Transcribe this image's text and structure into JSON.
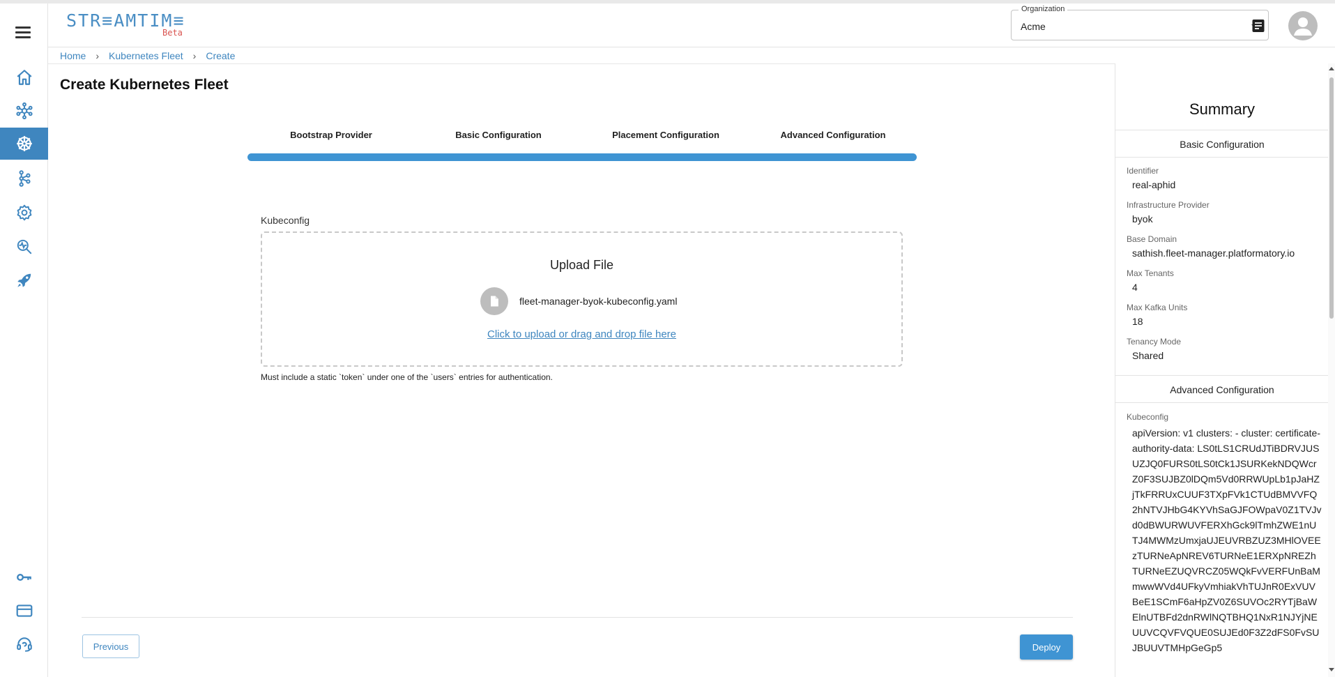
{
  "header": {
    "logo": "STR≡AMTIM≡",
    "logo_badge": "Beta",
    "organization_label": "Organization",
    "organization_value": "Acme"
  },
  "sidebar": {
    "items": [
      {
        "icon": "home-icon"
      },
      {
        "icon": "cluster-network-icon"
      },
      {
        "icon": "kubernetes-wheel-icon",
        "active": true
      },
      {
        "icon": "hub-nodes-icon"
      },
      {
        "icon": "settings-gear-icon"
      },
      {
        "icon": "monitoring-search-icon"
      },
      {
        "icon": "rocket-icon"
      },
      {
        "icon": "key-icon"
      },
      {
        "icon": "credit-card-icon"
      },
      {
        "icon": "support-headset-icon"
      }
    ],
    "accent_color": "#3f86bf"
  },
  "breadcrumb": [
    "Home",
    "Kubernetes Fleet",
    "Create"
  ],
  "page_title": "Create Kubernetes Fleet",
  "stepper": {
    "steps": [
      "Bootstrap Provider",
      "Basic Configuration",
      "Placement Configuration",
      "Advanced Configuration"
    ],
    "progress": 1.0
  },
  "upload": {
    "field_label": "Kubeconfig",
    "title": "Upload File",
    "file_name": "fleet-manager-byok-kubeconfig.yaml",
    "link_text": "Click to upload or drag and drop file here",
    "helper_text": "Must include a static `token` under one of the `users` entries for authentication."
  },
  "actions": {
    "previous_label": "Previous",
    "deploy_label": "Deploy"
  },
  "summary": {
    "title": "Summary",
    "basic_heading": "Basic Configuration",
    "fields": [
      {
        "label": "Identifier",
        "value": "real-aphid"
      },
      {
        "label": "Infrastructure Provider",
        "value": "byok"
      },
      {
        "label": "Base Domain",
        "value": "sathish.fleet-manager.platformatory.io"
      },
      {
        "label": "Max Tenants",
        "value": "4"
      },
      {
        "label": "Max Kafka Units",
        "value": "18"
      },
      {
        "label": "Tenancy Mode",
        "value": "Shared"
      }
    ],
    "advanced_heading": "Advanced Configuration",
    "kubeconfig_label": "Kubeconfig",
    "kubeconfig_value": "apiVersion: v1 clusters: - cluster: certificate-authority-data: LS0tLS1CRUdJTiBDRVJUSUZJQ0FURS0tLS0tCk1JSURKekNDQWcrZ0F3SUJBZ0lDQm5Vd0RRWUpLb1pJaHZjTkFRRUxCUUF3TXpFVk1CTUdBMVVFQ2hNTVJHbG4KYVhSaGJFOWpaV0Z1TVJvd0dBWURWUVFERXhGck9lTmhZWE1nUTJ4MWMzUmxjaUJEUVRBZUZ3MHlOVEEzTURNeApNREV6TURNeE1ERXpNREZhTURNeEZUQVRCZ05WQkFvVERFUnBaMmwwWVd4UFkyVmhiakVhTUJnR0ExVUVBeE1SCmF6aHpZV0Z6SUVOc2RYTjBaWElnUTBFd2dnRWlNQTBHQ1NxR1NJYjNEUUVCQVFVQUE0SUJEd0F3Z2dFS0FvSUJBUUVTMHpGeGp5"
  }
}
